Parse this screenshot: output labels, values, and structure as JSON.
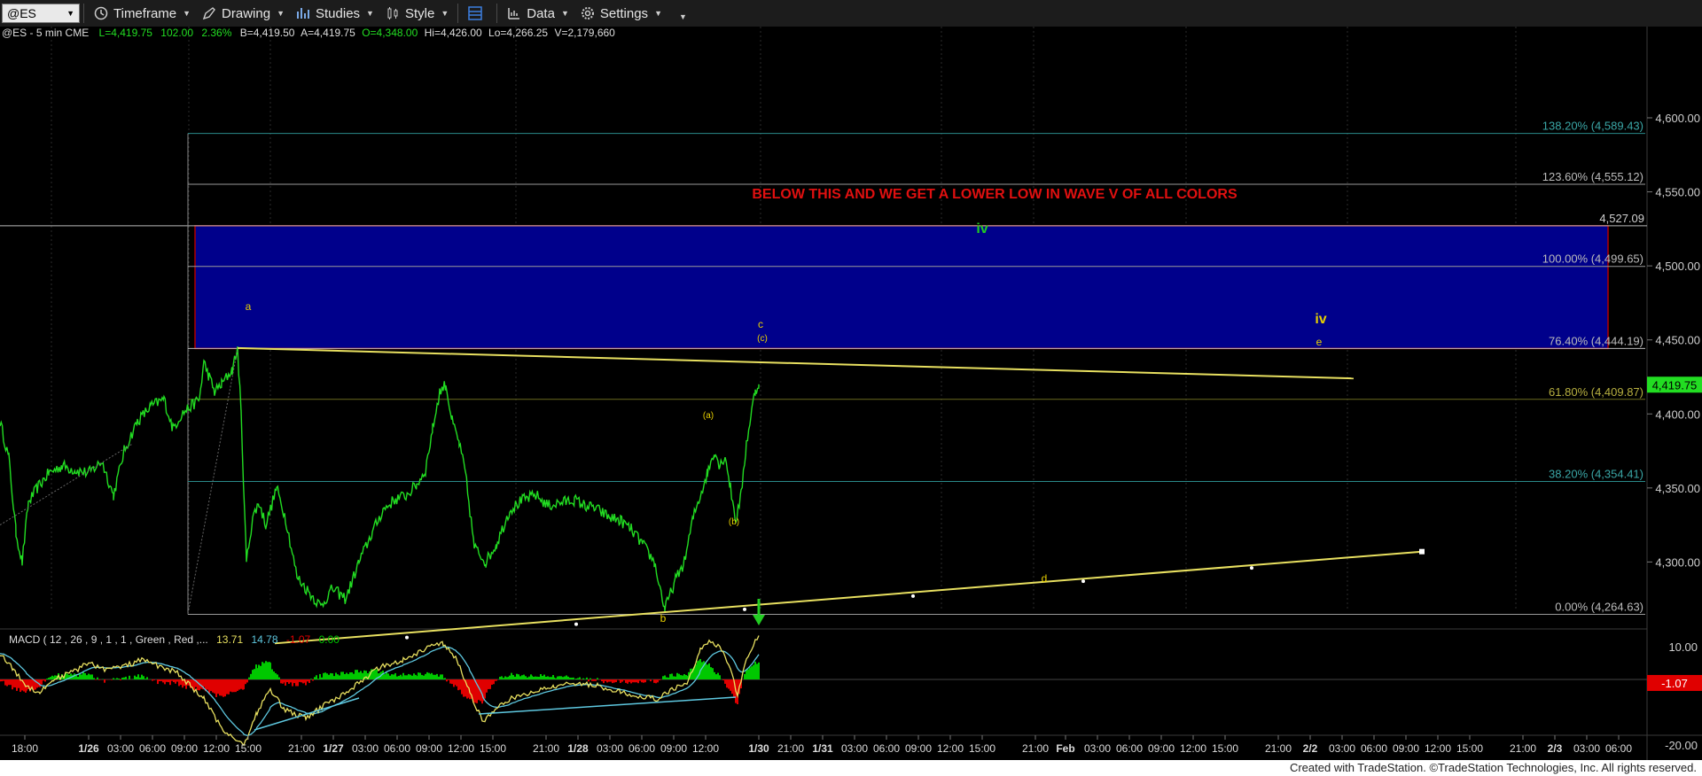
{
  "toolbar": {
    "symbol": "@ES",
    "timeframe_label": "Timeframe",
    "drawing_label": "Drawing",
    "studies_label": "Studies",
    "style_label": "Style",
    "data_label": "Data",
    "settings_label": "Settings"
  },
  "header": {
    "symbol_info": "@ES - 5 min  CME",
    "last": "L=4,419.75",
    "change": "102.00",
    "change_pct": "2.36%",
    "bid": "B=4,419.50",
    "ask": "A=4,419.75",
    "open": "O=4,348.00",
    "high": "Hi=4,426.00",
    "low": "Lo=4,266.25",
    "volume": "V=2,179,660"
  },
  "annotation_banner": "BELOW THIS AND WE GET A LOWER LOW IN WAVE V OF ALL COLORS",
  "colors": {
    "background": "#000000",
    "price": "#22dd22",
    "fib_line": "#2a8a8a",
    "fib_label": "#3aa6a6",
    "box_fill": "#00008b",
    "box_border": "#b00000",
    "banner": "#e01010",
    "trendline": "#e8e060",
    "wave_green": "#22cc22",
    "wave_yellow": "#e8d000",
    "macd_line": "#e8e060",
    "signal_line": "#5ec8e0",
    "hist_up": "#00c800",
    "hist_down": "#e00000"
  },
  "wave_labels": {
    "a": "a",
    "b": "b",
    "c": "c",
    "c_paren": "(c)",
    "a_paren": "(a)",
    "b_paren": "(b)",
    "d": "d",
    "e": "e",
    "iv_green": "iv",
    "iv_yellow": "iv"
  },
  "fib_levels": [
    {
      "label": "138.20% (4,589.43)",
      "price": 4589.43
    },
    {
      "label": "123.60% (4,555.12)",
      "price": 4555.12
    },
    {
      "label": "100.00% (4,499.65)",
      "price": 4499.65
    },
    {
      "label": "76.40% (4,444.19)",
      "price": 4444.19
    },
    {
      "label": "61.80% (4,409.87)",
      "price": 4409.87
    },
    {
      "label": "38.20% (4,354.41)",
      "price": 4354.41
    },
    {
      "label": "0.00% (4,264.63)",
      "price": 4264.63
    }
  ],
  "box": {
    "top_price": 4527.09,
    "bottom_price": 4444.19,
    "top_label": "4,527.09"
  },
  "price_axis": {
    "labels": [
      "4,600.00",
      "4,550.00",
      "4,500.00",
      "4,450.00",
      "4,400.00",
      "4,350.00",
      "4,300.00"
    ],
    "values": [
      4600,
      4550,
      4500,
      4450,
      4400,
      4350,
      4300
    ],
    "last_price_label": "4,419.75",
    "last_price": 4419.75
  },
  "macd": {
    "label": "MACD ( 12 , 26 , 9 , 1 , 1 , Green , Red ,...",
    "macd_value": "13.71",
    "signal_value": "14.78",
    "diff_value": "-1.07",
    "zero_value": "0.00",
    "axis_labels": [
      "10.00",
      "-20.00"
    ],
    "axis_values": [
      10,
      -20
    ],
    "badge": "-1.07"
  },
  "time_axis": {
    "labels": [
      "18:00",
      "1/26",
      "03:00",
      "06:00",
      "09:00",
      "12:00",
      "15:00",
      "21:00",
      "1/27",
      "03:00",
      "06:00",
      "09:00",
      "12:00",
      "15:00",
      "21:00",
      "1/28",
      "03:00",
      "06:00",
      "09:00",
      "12:00",
      "1/30",
      "21:00",
      "1/31",
      "03:00",
      "06:00",
      "09:00",
      "12:00",
      "15:00",
      "21:00",
      "Feb",
      "03:00",
      "06:00",
      "09:00",
      "12:00",
      "15:00",
      "21:00",
      "2/2",
      "03:00",
      "06:00",
      "09:00",
      "12:00",
      "15:00",
      "21:00",
      "2/3",
      "03:00",
      "06:00"
    ]
  },
  "footer": "Created with TradeStation. ©TradeStation Technologies, Inc. All rights reserved."
}
